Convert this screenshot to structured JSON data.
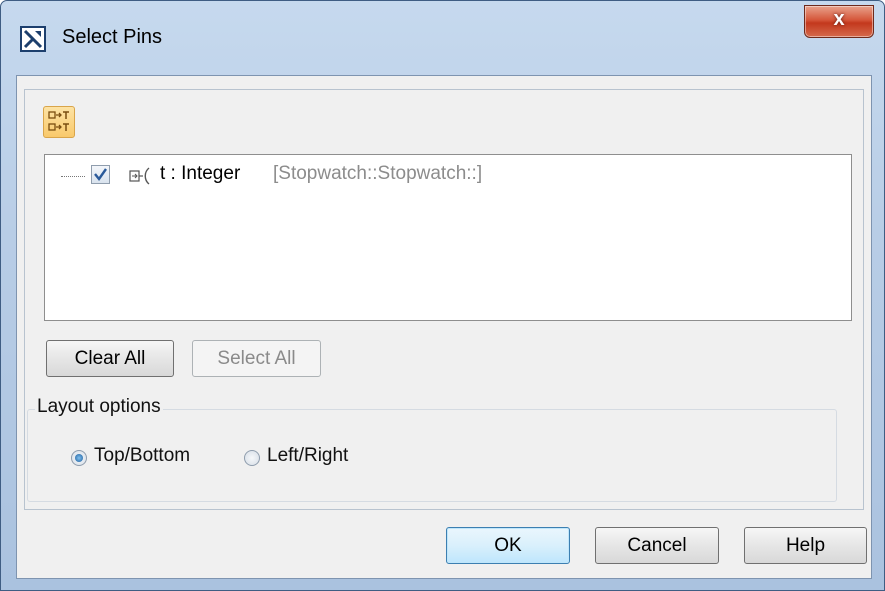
{
  "window": {
    "title": "Select Pins",
    "close_label": "x"
  },
  "toolbar": {
    "toggle_icon": "pin-display-toggle-icon"
  },
  "tree": {
    "items": [
      {
        "checked": true,
        "icon": "pin-icon",
        "name": "t : Integer",
        "owner": "[Stopwatch::Stopwatch::]"
      }
    ]
  },
  "selection_buttons": {
    "clear_all": "Clear All",
    "select_all": "Select All"
  },
  "layout_options": {
    "legend": "Layout options",
    "options": [
      {
        "label": "Top/Bottom",
        "selected": true
      },
      {
        "label": "Left/Right",
        "selected": false
      }
    ]
  },
  "dialog_buttons": {
    "ok": "OK",
    "cancel": "Cancel",
    "help": "Help"
  }
}
